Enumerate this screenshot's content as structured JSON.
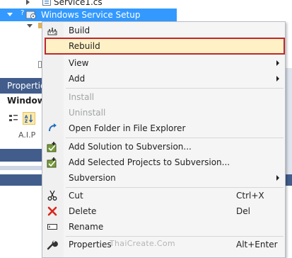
{
  "tree": {
    "file_item": "Service1.cs",
    "selected_project": "Windows Service Setup"
  },
  "properties": {
    "header": "Properties",
    "object_title": "Windows",
    "row_fragment": "A.I.P"
  },
  "menu": {
    "items": [
      {
        "label": "Build",
        "icon": "build-icon",
        "enabled": true
      },
      {
        "label": "Rebuild",
        "icon": "rebuild-icon",
        "enabled": true,
        "highlighted": true
      },
      {
        "label": "View",
        "enabled": true,
        "submenu": true
      },
      {
        "label": "Add",
        "enabled": true,
        "submenu": true
      },
      {
        "label": "Install",
        "enabled": false
      },
      {
        "label": "Uninstall",
        "enabled": false
      },
      {
        "label": "Open Folder in File Explorer",
        "icon": "open-folder-arrow-icon",
        "enabled": true
      },
      {
        "label": "Add Solution to Subversion...",
        "icon": "subversion-add-icon",
        "enabled": true
      },
      {
        "label": "Add Selected Projects to Subversion...",
        "icon": "subversion-add-icon",
        "enabled": true
      },
      {
        "label": "Subversion",
        "enabled": true,
        "submenu": true
      },
      {
        "label": "Cut",
        "icon": "scissors-icon",
        "shortcut": "Ctrl+X",
        "enabled": true
      },
      {
        "label": "Delete",
        "icon": "delete-x-icon",
        "shortcut": "Del",
        "enabled": true
      },
      {
        "label": "Rename",
        "icon": "rename-icon",
        "enabled": true
      },
      {
        "label": "Properties",
        "icon": "wrench-icon",
        "shortcut": "Alt+Enter",
        "enabled": true
      }
    ]
  },
  "watermark": "ThaiCreate.Com",
  "colors": {
    "selection": "#3399ff",
    "highlight_border": "#c0272d",
    "highlight_fill": "#fff1c6",
    "panel_header": "#425d8c",
    "delete_red": "#d9261c"
  }
}
